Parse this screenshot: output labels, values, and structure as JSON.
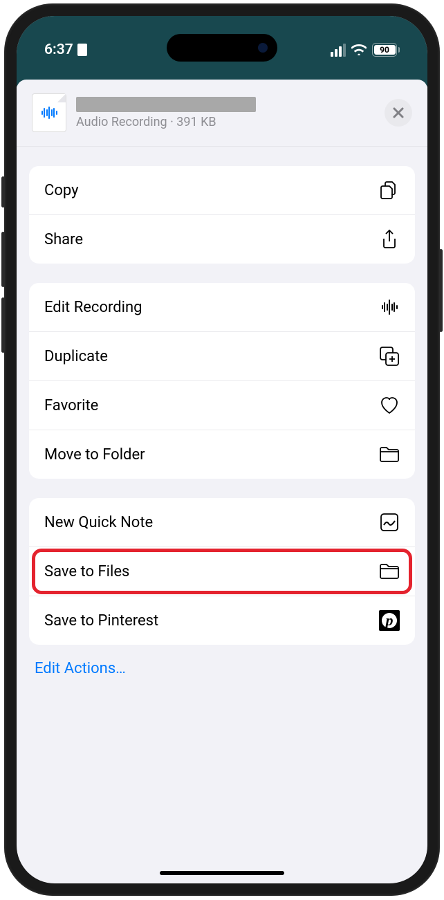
{
  "status": {
    "time": "6:37",
    "battery": "90"
  },
  "header": {
    "subtitle": "Audio Recording · 391 KB"
  },
  "groups": [
    {
      "rows": [
        {
          "label": "Copy",
          "icon": "copy-icon"
        },
        {
          "label": "Share",
          "icon": "share-icon"
        }
      ]
    },
    {
      "rows": [
        {
          "label": "Edit Recording",
          "icon": "waveform-icon"
        },
        {
          "label": "Duplicate",
          "icon": "duplicate-icon"
        },
        {
          "label": "Favorite",
          "icon": "heart-icon"
        },
        {
          "label": "Move to Folder",
          "icon": "folder-icon"
        }
      ]
    },
    {
      "rows": [
        {
          "label": "New Quick Note",
          "icon": "quicknote-icon"
        },
        {
          "label": "Save to Files",
          "icon": "folder-icon",
          "highlight": true
        },
        {
          "label": "Save to Pinterest",
          "icon": "pinterest-icon"
        }
      ]
    }
  ],
  "footer": {
    "edit_actions": "Edit Actions…"
  }
}
